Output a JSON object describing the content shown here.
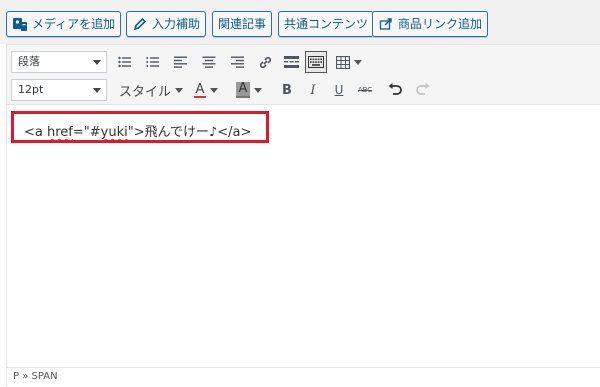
{
  "media_buttons": [
    {
      "label": "メディアを追加",
      "icon": "media-add-icon"
    },
    {
      "label": "入力補助",
      "icon": "pencil-icon"
    },
    {
      "label": "関連記事",
      "icon": ""
    },
    {
      "label": "共通コンテンツ",
      "icon": ""
    },
    {
      "label": "商品リンク追加",
      "icon": "share-icon"
    }
  ],
  "toolbar": {
    "format_select": "段落",
    "fontsize_select": "12pt",
    "style_label": "スタイル",
    "text_color_label": "A",
    "bg_color_label": "A",
    "bold_label": "B",
    "italic_label": "I",
    "underline_label": "U",
    "strike_label": "ABC",
    "text_color": "#d63638",
    "bg_color": "#888888"
  },
  "editor": {
    "code_prefix": "<a ",
    "code_href": "href",
    "code_eq": "=\"#",
    "code_yuki": "yuki",
    "code_rest": "\">飛んでけー♪</a>",
    "highlight_color": "#e3172a"
  },
  "status": {
    "path": "P » SPAN"
  }
}
